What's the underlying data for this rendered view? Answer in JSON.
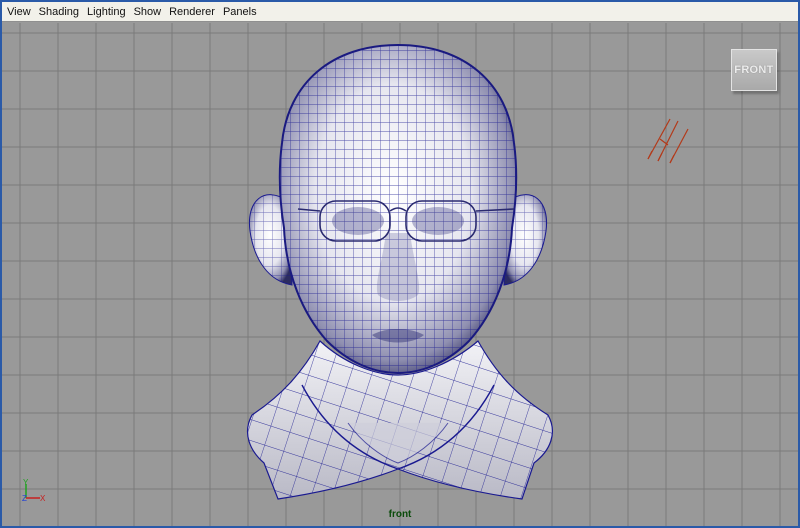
{
  "menubar": {
    "items": [
      {
        "id": "view",
        "label": "View"
      },
      {
        "id": "shading",
        "label": "Shading"
      },
      {
        "id": "lighting",
        "label": "Lighting"
      },
      {
        "id": "show",
        "label": "Show"
      },
      {
        "id": "renderer",
        "label": "Renderer"
      },
      {
        "id": "panels",
        "label": "Panels"
      }
    ]
  },
  "viewport": {
    "camera_name": "front",
    "view_cube_label": "FRONT",
    "axis": {
      "y_label": "Y",
      "z_label": "Z",
      "x_label": "X"
    },
    "colors": {
      "background": "#999999",
      "grid": "#7a7a7a",
      "wireframe": "#1a1a90",
      "axis_y": "#1fa31f",
      "axis_z": "#1f3fd6",
      "axis_x": "#c81f1f",
      "light": "#b33a1a",
      "camera_label": "#0b4b0b"
    }
  }
}
